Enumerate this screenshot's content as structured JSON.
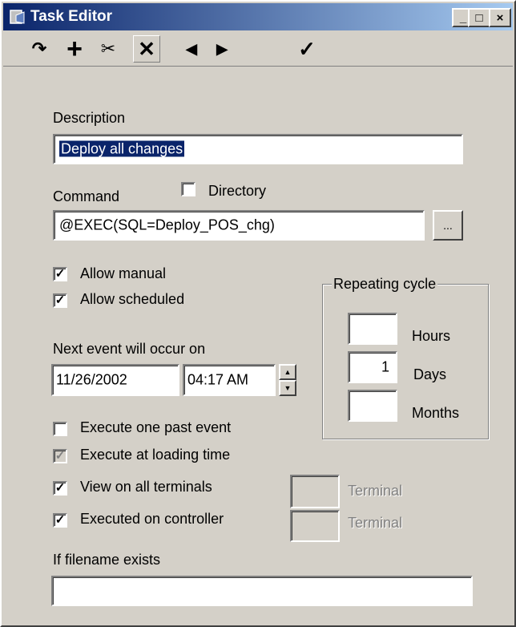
{
  "window": {
    "title": "Task Editor",
    "min": "_",
    "max": "□",
    "close": "×"
  },
  "toolbar": {
    "redo": "↷",
    "add": "+",
    "cut": "✂",
    "delete": "✕",
    "prev": "◀",
    "next": "▶",
    "confirm": "✓"
  },
  "form": {
    "description_label": "Description",
    "description_value": "Deploy all changes",
    "command_label": "Command",
    "directory_label": "Directory",
    "directory_checked": "",
    "command_value": "@EXEC(SQL=Deploy_POS_chg)",
    "browse_label": "...",
    "allow_manual_label": "Allow manual",
    "allow_manual_checked": "✓",
    "allow_scheduled_label": "Allow scheduled",
    "allow_scheduled_checked": "✓",
    "next_event_label": "Next event will occur on",
    "next_date": "11/26/2002",
    "next_time": "04:17 AM",
    "repeating_cycle_label": "Repeating cycle",
    "hours_label": "Hours",
    "hours_value": "",
    "days_label": "Days",
    "days_value": "1",
    "months_label": "Months",
    "months_value": "",
    "execute_past_label": "Execute one past event",
    "execute_past_checked": "",
    "execute_loading_label": "Execute at loading time",
    "execute_loading_checked": "✓",
    "view_all_label": "View on all terminals",
    "view_all_checked": "✓",
    "executed_controller_label": "Executed on controller",
    "executed_controller_checked": "✓",
    "terminal1_label": "Terminal",
    "terminal2_label": "Terminal",
    "filename_exists_label": "If filename exists",
    "filename_value": ""
  },
  "icons": {
    "app": "task-editor-icon",
    "spin_up": "▲",
    "spin_down": "▼"
  }
}
